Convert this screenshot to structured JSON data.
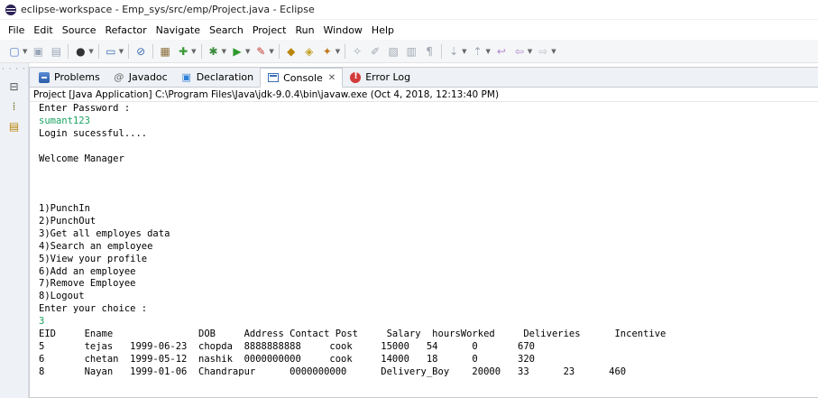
{
  "window": {
    "title": "eclipse-workspace - Emp_sys/src/emp/Project.java - Eclipse"
  },
  "menu": [
    "File",
    "Edit",
    "Source",
    "Refactor",
    "Navigate",
    "Search",
    "Project",
    "Run",
    "Window",
    "Help"
  ],
  "tabs": [
    {
      "label": "Problems",
      "icon": "problems-icon"
    },
    {
      "label": "Javadoc",
      "icon": "javadoc-icon"
    },
    {
      "label": "Declaration",
      "icon": "declaration-icon"
    },
    {
      "label": "Console",
      "icon": "console-icon",
      "active": true
    },
    {
      "label": "Error Log",
      "icon": "error-log-icon"
    }
  ],
  "console": {
    "process_label": "Project [Java Application] C:\\Program Files\\Java\\jdk-9.0.4\\bin\\javaw.exe (Oct 4, 2018, 12:13:40 PM)",
    "lines": [
      {
        "text": "Enter Password :",
        "input": false
      },
      {
        "text": "sumant123",
        "input": true
      },
      {
        "text": "Login sucessful....",
        "input": false
      },
      {
        "text": "",
        "input": false
      },
      {
        "text": "Welcome Manager",
        "input": false
      },
      {
        "text": "",
        "input": false
      },
      {
        "text": "",
        "input": false
      },
      {
        "text": "",
        "input": false
      },
      {
        "text": "1)PunchIn",
        "input": false
      },
      {
        "text": "2)PunchOut",
        "input": false
      },
      {
        "text": "3)Get all employes data",
        "input": false
      },
      {
        "text": "4)Search an employee",
        "input": false
      },
      {
        "text": "5)View your profile",
        "input": false
      },
      {
        "text": "6)Add an employee",
        "input": false
      },
      {
        "text": "7)Remove Employee",
        "input": false
      },
      {
        "text": "8)Logout",
        "input": false
      },
      {
        "text": "Enter your choice :",
        "input": false
      },
      {
        "text": "3",
        "input": true
      },
      {
        "text": "EID     Ename               DOB     Address Contact Post     Salary  hoursWorked     Deliveries      Incentive",
        "input": false
      },
      {
        "text": "5       tejas   1999-06-23  chopda  8888888888     cook     15000   54      0       670",
        "input": false
      },
      {
        "text": "6       chetan  1999-05-12  nashik  0000000000     cook     14000   18      0       320",
        "input": false
      },
      {
        "text": "8       Nayan   1999-01-06  Chandrapur      0000000000      Delivery_Boy    20000   33      23      460",
        "input": false
      }
    ]
  },
  "colors": {
    "input_text": "#1aa260",
    "tab_bg": "#eef1f5",
    "border": "#c8ccd2"
  }
}
